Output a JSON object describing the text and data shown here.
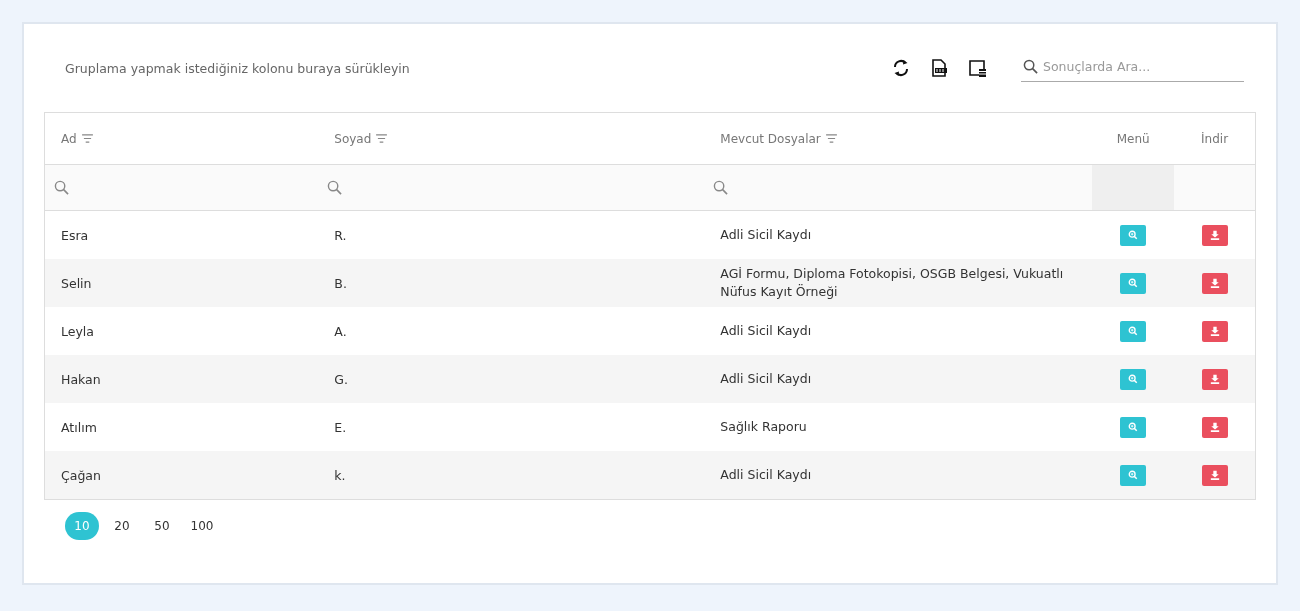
{
  "group_hint": "Gruplama yapmak istediğiniz kolonu buraya sürükleyin",
  "search": {
    "placeholder": "Sonuçlarda Ara..."
  },
  "columns": [
    {
      "label": "Ad",
      "filter": true
    },
    {
      "label": "Soyad",
      "filter": true
    },
    {
      "label": "Mevcut Dosyalar",
      "filter": true
    },
    {
      "label": "Menü",
      "filter": false
    },
    {
      "label": "İndir",
      "filter": false
    }
  ],
  "rows": [
    {
      "ad": "Esra",
      "soyad": "R.",
      "dosyalar": "Adli Sicil Kaydı"
    },
    {
      "ad": "Selin",
      "soyad": "B.",
      "dosyalar": "AGİ Formu, Diploma Fotokopisi, OSGB Belgesi, Vukuatlı Nüfus Kayıt Örneği"
    },
    {
      "ad": "Leyla",
      "soyad": "A.",
      "dosyalar": "Adli Sicil Kaydı"
    },
    {
      "ad": "Hakan",
      "soyad": "G.",
      "dosyalar": "Adli Sicil Kaydı"
    },
    {
      "ad": "Atılım",
      "soyad": "E.",
      "dosyalar": "Sağlık Raporu"
    },
    {
      "ad": "Çağan",
      "soyad": "k.",
      "dosyalar": "Adli Sicil Kaydı"
    }
  ],
  "page_sizes": [
    {
      "label": "10",
      "selected": true
    },
    {
      "label": "20",
      "selected": false
    },
    {
      "label": "50",
      "selected": false
    },
    {
      "label": "100",
      "selected": false
    }
  ]
}
